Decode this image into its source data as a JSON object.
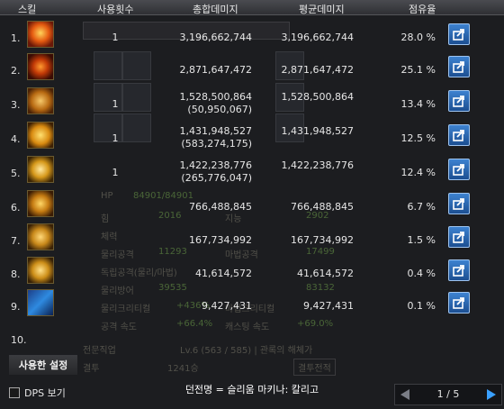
{
  "header": {
    "skill": "스킬",
    "count": "사용횟수",
    "total": "총합데미지",
    "avg": "평균데미지",
    "share": "점유율"
  },
  "rows": [
    {
      "n": "1.",
      "cnt": "1",
      "total": "3,196,662,744",
      "total_sub": "",
      "avg": "3,196,662,744",
      "pct": "28.0 %",
      "icon": "fire-skill-icon"
    },
    {
      "n": "2.",
      "cnt": "",
      "total": "2,871,647,472",
      "total_sub": "",
      "avg": "2,871,647,472",
      "pct": "25.1 %",
      "icon": "eye-skill-icon"
    },
    {
      "n": "3.",
      "cnt": "1",
      "total": "1,528,500,864",
      "total_sub": "(50,950,067)",
      "avg": "1,528,500,864",
      "pct": "13.4 %",
      "icon": "figure-skill-icon"
    },
    {
      "n": "4.",
      "cnt": "1",
      "total": "1,431,948,527",
      "total_sub": "(583,274,175)",
      "avg": "1,431,948,527",
      "pct": "12.5 %",
      "icon": "bolt-skill-icon"
    },
    {
      "n": "5.",
      "cnt": "1",
      "total": "1,422,238,776",
      "total_sub": "(265,776,047)",
      "avg": "1,422,238,776",
      "pct": "12.4 %",
      "icon": "swirl-skill-icon"
    },
    {
      "n": "6.",
      "cnt": "",
      "total": "766,488,845",
      "total_sub": "",
      "avg": "766,488,845",
      "pct": "6.7 %",
      "icon": "crown-skill-icon"
    },
    {
      "n": "7.",
      "cnt": "",
      "total": "167,734,992",
      "total_sub": "",
      "avg": "167,734,992",
      "pct": "1.5 %",
      "icon": "face-skill-icon"
    },
    {
      "n": "8.",
      "cnt": "",
      "total": "41,614,572",
      "total_sub": "",
      "avg": "41,614,572",
      "pct": "0.4 %",
      "icon": "ring-skill-icon"
    },
    {
      "n": "9.",
      "cnt": "",
      "total": "9,427,431",
      "total_sub": "",
      "avg": "9,427,431",
      "pct": "0.1 %",
      "icon": "blue-skill-icon"
    },
    {
      "n": "10.",
      "cnt": "",
      "total": "",
      "total_sub": "",
      "avg": "",
      "pct": "",
      "icon": ""
    }
  ],
  "ghost": {
    "stat1": "힘",
    "stat2": "지능",
    "stat3": "체력",
    "stat4": "물리공격",
    "stat5": "마법공격",
    "stat6": "독립공격(물리/마법)",
    "stat7": "물리방어",
    "stat8": "물리크리티컬",
    "stat9": "마법크리티컬",
    "stat10": "공격 속도",
    "stat11": "캐스팅 속도",
    "job": "전문직업",
    "job_val": "Lv.6 (563 / 585) | 관록의 해체가",
    "duel": "결투",
    "duel_val": "1241승",
    "duel_btn": "결투전적",
    "v1": "2016",
    "v2": "2902",
    "v3": "11293",
    "v4": "17499",
    "v5": "39535",
    "v6": "83132",
    "v7": "+436%",
    "v8": "+66.4%",
    "v9": "+69.0%",
    "hp": "HP",
    "hp_val": "84901/84901"
  },
  "footer": {
    "used_settings": "사용한 설정",
    "dps_label": "DPS 보기",
    "character": "던전명 = 슬리움 마키나: 칼리고",
    "page": "1 / 5"
  },
  "colors": {
    "accent": "#2e6fbf",
    "header_bg": "#3a3b3f",
    "text": "#e6e6e6"
  }
}
